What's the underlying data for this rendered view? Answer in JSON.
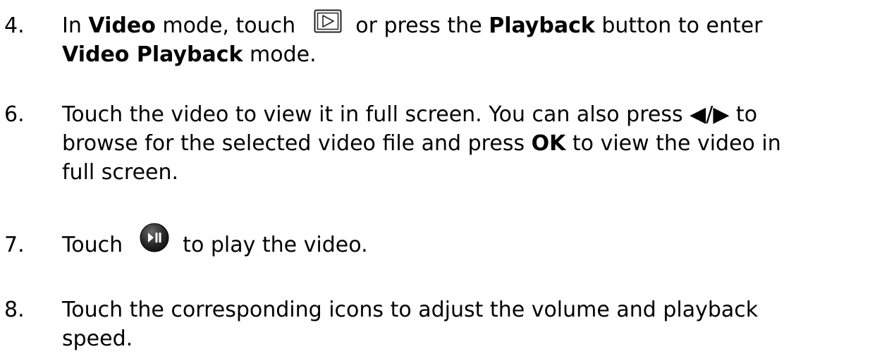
{
  "steps": [
    {
      "number": "4.",
      "lines": [
        [
          {
            "t": "In ",
            "b": false
          },
          {
            "t": "Video",
            "b": true
          },
          {
            "t": " mode, touch ",
            "b": false
          },
          {
            "icon": "playback-mode-icon"
          },
          {
            "t": " or press the ",
            "b": false
          },
          {
            "t": "Playback",
            "b": true
          },
          {
            "t": " button to enter",
            "b": false
          }
        ],
        [
          {
            "t": "Video Playback",
            "b": true
          },
          {
            "t": " mode.",
            "b": false
          }
        ]
      ]
    },
    {
      "number": "6.",
      "lines": [
        [
          {
            "t": "Touch the video to view it in full screen. You can also press ◀/▶ to",
            "b": false
          }
        ],
        [
          {
            "t": "browse for the selected video file and press ",
            "b": false
          },
          {
            "t": "OK",
            "b": true
          },
          {
            "t": " to view the video in",
            "b": false
          }
        ],
        [
          {
            "t": "full screen.",
            "b": false
          }
        ]
      ]
    },
    {
      "number": "7.",
      "lines": [
        [
          {
            "t": "Touch ",
            "b": false
          },
          {
            "icon": "play-pause-icon"
          },
          {
            "t": " to play the video.",
            "b": false
          }
        ]
      ]
    },
    {
      "number": "8.",
      "lines": [
        [
          {
            "t": "Touch the corresponding icons to adjust the volume and playback",
            "b": false
          }
        ],
        [
          {
            "t": "speed.",
            "b": false
          }
        ]
      ]
    }
  ]
}
